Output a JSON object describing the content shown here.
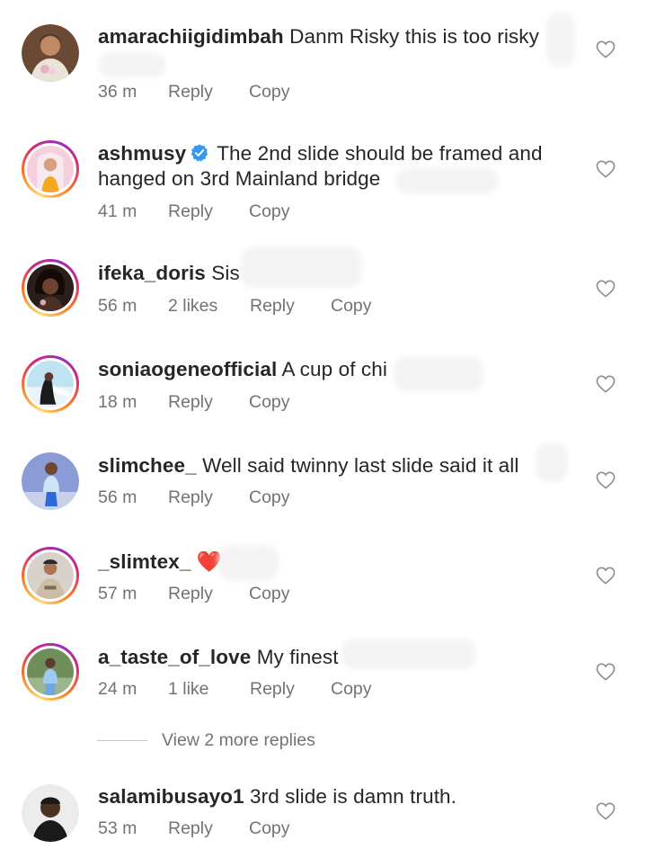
{
  "comments": [
    {
      "username": "amarachiigidimbah",
      "verified": false,
      "text": "Danm Risky this is too risky",
      "time": "36 m",
      "likes": "",
      "reply": "Reply",
      "copy": "Copy",
      "story_ring": false
    },
    {
      "username": "ashmusy",
      "verified": true,
      "text": "The 2nd slide should be framed and hanged on 3rd Mainland bridge",
      "time": "41 m",
      "likes": "",
      "reply": "Reply",
      "copy": "Copy",
      "story_ring": true
    },
    {
      "username": "ifeka_doris",
      "verified": false,
      "text": "Sis",
      "time": "56 m",
      "likes": "2 likes",
      "reply": "Reply",
      "copy": "Copy",
      "story_ring": true
    },
    {
      "username": "soniaogeneofficial",
      "verified": false,
      "text": "A cup of chi",
      "time": "18 m",
      "likes": "",
      "reply": "Reply",
      "copy": "Copy",
      "story_ring": true
    },
    {
      "username": "slimchee_",
      "verified": false,
      "text": "Well said twinny last slide said it all",
      "time": "56 m",
      "likes": "",
      "reply": "Reply",
      "copy": "Copy",
      "story_ring": false
    },
    {
      "username": "_slimtex_",
      "verified": false,
      "text": "❤️",
      "time": "57 m",
      "likes": "",
      "reply": "Reply",
      "copy": "Copy",
      "story_ring": true
    },
    {
      "username": "a_taste_of_love",
      "verified": false,
      "text": "My finest",
      "time": "24 m",
      "likes": "1 like",
      "reply": "Reply",
      "copy": "Copy",
      "story_ring": true
    },
    {
      "username": "salamibusayo1",
      "verified": false,
      "text": "3rd slide is damn truth.",
      "time": "53 m",
      "likes": "",
      "reply": "Reply",
      "copy": "Copy",
      "story_ring": false
    }
  ],
  "view_more_replies": "View 2 more replies",
  "icons": {
    "like": "heart-outline-icon",
    "verified": "verified-badge-icon"
  },
  "colors": {
    "primary_text": "#262626",
    "secondary_text": "#737373",
    "verified_blue": "#3897f0",
    "heart_outline": "#8e8e8e"
  }
}
